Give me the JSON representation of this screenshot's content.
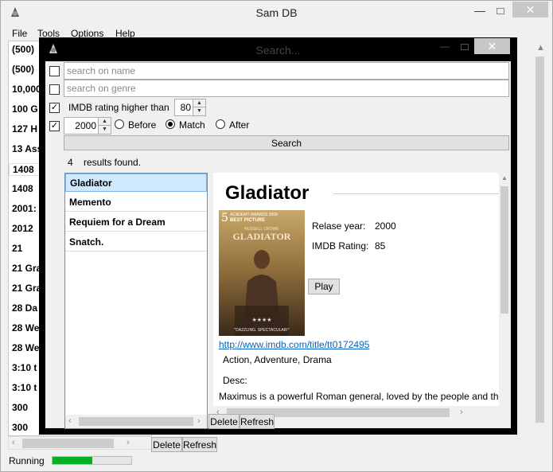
{
  "main": {
    "title": "Sam DB",
    "menu": [
      "File",
      "Tools",
      "Options",
      "Help"
    ],
    "list_items": [
      "(500)",
      "(500)",
      "10,000",
      "100 G",
      "127 H",
      "13 Ass",
      "1408",
      "1408",
      "2001:",
      "2012",
      "21",
      "21 Gra",
      "21 Gra",
      "28 Da",
      "28 We",
      "28 We",
      "3:10 t",
      "3:10 t",
      "300",
      "300"
    ],
    "selected_index": 6,
    "delete_label": "Delete",
    "refresh_label": "Refresh",
    "status": "Running",
    "progress": 0.5
  },
  "dialog": {
    "title": "Search...",
    "name_placeholder": "search on name",
    "genre_placeholder": "search on genre",
    "rating_label": "IMDB rating higher than",
    "rating_value": "80",
    "year_value": "2000",
    "before_label": "Before",
    "match_label": "Match",
    "after_label": "After",
    "search_label": "Search",
    "results_count": "4",
    "results_label": "results found.",
    "results": [
      "Gladiator",
      "Memento",
      "Requiem for a Dream",
      "Snatch."
    ],
    "selected_result": 0,
    "delete_label": "Delete",
    "refresh_label": "Refresh",
    "checks": {
      "name": false,
      "genre": false,
      "rating": true,
      "year": true
    },
    "year_mode": "Match"
  },
  "detail": {
    "title": "Gladiator",
    "release_label": "Relase year:",
    "release_value": "2000",
    "rating_label": "IMDB Rating:",
    "rating_value": "85",
    "play_label": "Play",
    "link": "http://www.imdb.com/title/tt0172495",
    "genres": "Action, Adventure, Drama",
    "desc_label": "Desc:",
    "desc": "Maximus is a powerful Roman general, loved by the people and the",
    "poster": {
      "awards_number": "5",
      "awards_text": "ACADEMY AWARDS 2000",
      "best_picture": "BEST PICTURE",
      "actor": "RUSSELL CROWE",
      "title": "GLADIATOR",
      "tagline": "\"DAZZLING. SPECTACULAR!\""
    }
  },
  "colors": {
    "accent": "#0563c1",
    "selection": "#cde8ff",
    "progress": "#06b025",
    "close": "#c7c7c7"
  }
}
